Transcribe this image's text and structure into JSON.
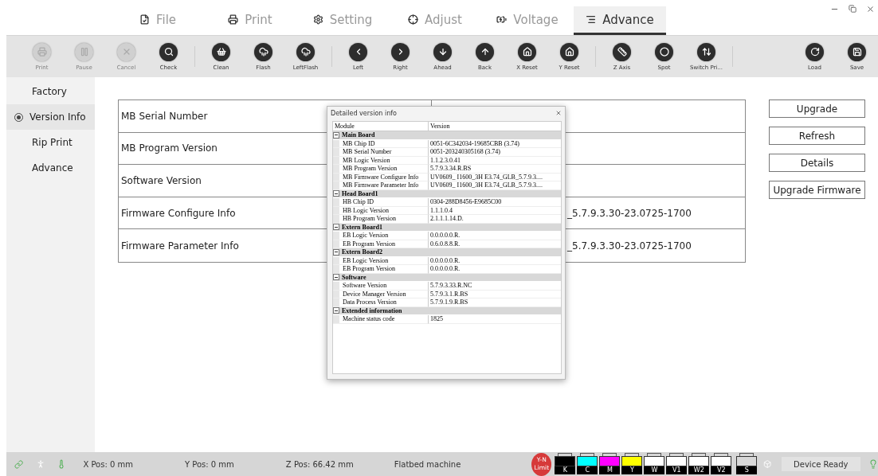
{
  "tabs": [
    {
      "label": "File",
      "selected": false
    },
    {
      "label": "Print",
      "selected": false
    },
    {
      "label": "Setting",
      "selected": false
    },
    {
      "label": "Adjust",
      "selected": false
    },
    {
      "label": "Voltage",
      "selected": false
    },
    {
      "label": "Advance",
      "selected": true
    }
  ],
  "toolbar": {
    "groups": [
      [
        {
          "label": "Print",
          "disabled": true
        },
        {
          "label": "Pause",
          "disabled": true
        },
        {
          "label": "Cancel",
          "disabled": true
        },
        {
          "label": "Check",
          "disabled": false
        }
      ],
      [
        {
          "label": "Clean",
          "disabled": false
        },
        {
          "label": "Flash",
          "disabled": false
        },
        {
          "label": "LeftFlash",
          "disabled": false
        }
      ],
      [
        {
          "label": "Left",
          "disabled": false
        },
        {
          "label": "Right",
          "disabled": false
        },
        {
          "label": "Ahead",
          "disabled": false
        },
        {
          "label": "Back",
          "disabled": false
        },
        {
          "label": "X Reset",
          "disabled": false
        },
        {
          "label": "Y Reset",
          "disabled": false
        }
      ],
      [
        {
          "label": "Z Axis",
          "disabled": false
        },
        {
          "label": "Spot",
          "disabled": false
        },
        {
          "label": "Switch Pri...",
          "disabled": false
        }
      ]
    ],
    "right": [
      {
        "label": "Load",
        "disabled": false
      },
      {
        "label": "Save",
        "disabled": false
      }
    ]
  },
  "sidebar": {
    "items": [
      {
        "label": "Factory",
        "selected": false
      },
      {
        "label": "Version Info",
        "selected": true
      },
      {
        "label": "Rip Print",
        "selected": false
      },
      {
        "label": "Advance",
        "selected": false
      }
    ]
  },
  "info_table": {
    "rows": [
      {
        "label": "MB Serial Number"
      },
      {
        "label": "MB Program Version"
      },
      {
        "label": "Software Version"
      },
      {
        "label": "Firmware Configure Info",
        "value": "_5.7.9.3.30-23.0725-1700"
      },
      {
        "label": "Firmware Parameter Info",
        "value": "_5.7.9.3.30-23.0725-1700"
      }
    ]
  },
  "actions": [
    "Upgrade",
    "Refresh",
    "Details",
    "Upgrade Firmware"
  ],
  "dialog": {
    "title": "Detailed version info",
    "columns": [
      "Module",
      "Version"
    ],
    "groups": [
      {
        "name": "Main Board",
        "expanded": true,
        "children": [
          {
            "module": "MB Chip ID",
            "version": "0051-6C342034-19685CBB (3.74)"
          },
          {
            "module": "MB Serial Number",
            "version": "0051-203240305168 (3.74)"
          },
          {
            "module": "MB Logic Version",
            "version": "1.1.2.3.0.41"
          },
          {
            "module": "MB Program Version",
            "version": "5.7.9.3.34.R.BS"
          },
          {
            "module": "MB Firmware Configure Info",
            "version": "UV0609_ I1600_3H E3.74_GLB_5.7.9.3...."
          },
          {
            "module": "MB Firmware Parameter Info",
            "version": "UV0609_ I1600_3H E3.74_GLB_5.7.9.3...."
          }
        ]
      },
      {
        "name": "Head Board1",
        "expanded": true,
        "children": [
          {
            "module": "HB Chip ID",
            "version": "0304-288D8456-E9685C00"
          },
          {
            "module": "HB Logic Version",
            "version": "1.1.1.0.4"
          },
          {
            "module": "HB Program Version",
            "version": "2.1.1.1.14.D."
          }
        ]
      },
      {
        "name": "Extern Board1",
        "expanded": true,
        "children": [
          {
            "module": "EB Logic Version",
            "version": "0.0.0.0.0.R."
          },
          {
            "module": "EB Program Version",
            "version": "0.6.0.8.8.R."
          }
        ]
      },
      {
        "name": "Extern Board2",
        "expanded": true,
        "children": [
          {
            "module": "EB Logic Version",
            "version": "0.0.0.0.0.R."
          },
          {
            "module": "EB Program Version",
            "version": "0.0.0.0.0.R."
          }
        ]
      },
      {
        "name": "Software",
        "expanded": true,
        "children": [
          {
            "module": "Software Version",
            "version": "5.7.9.3.33.R.NC"
          },
          {
            "module": "Device Manager Version",
            "version": "5.7.9.3.1.R.BS"
          },
          {
            "module": "Data Process Version",
            "version": "5.7.9.1.9.R.BS"
          }
        ]
      },
      {
        "name": "Extended information",
        "expanded": true,
        "children": [
          {
            "module": "Machine status code",
            "version": "1825"
          }
        ]
      }
    ]
  },
  "status_bar": {
    "x_pos": "X Pos: 0 mm",
    "y_pos": "Y Pos: 0 mm",
    "z_pos": "Z Pos: 66.42 mm",
    "machine": "Flatbed machine",
    "limit": "Y-N Limit",
    "inks": [
      {
        "label": "K",
        "color": "#000000"
      },
      {
        "label": "C",
        "color": "#00ffff"
      },
      {
        "label": "M",
        "color": "#ff00ff"
      },
      {
        "label": "Y",
        "color": "#ffff00"
      },
      {
        "label": "W",
        "color": "#ffffff"
      },
      {
        "label": "V1",
        "color": "#ffffff"
      },
      {
        "label": "W2",
        "color": "#ffffff"
      },
      {
        "label": "V2",
        "color": "#ffffff"
      },
      {
        "label": "S",
        "color": "#d8d8d8"
      }
    ],
    "status": "Device Ready"
  }
}
